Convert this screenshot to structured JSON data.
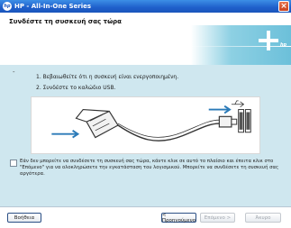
{
  "window": {
    "title": "HP - All-In-One Series",
    "app_icon": "hp-logo-icon",
    "close_glyph": "×"
  },
  "header": {
    "heading": "Συνδέστε τη συσκευή σας τώρα",
    "brand_text": "hp"
  },
  "content": {
    "dash": "-",
    "steps": [
      "1. Βεβαιωθείτε ότι η συσκευή είναι ενεργοποιημένη.",
      "2. Συνδέστε το καλώδιο USB."
    ],
    "illustration": "usb-cable-connection-illustration",
    "checkbox_checked": false,
    "note": "Εάν δεν μπορείτε να συνδέσετε τη συσκευή σας τώρα, κάντε κλικ σε αυτό το πλαίσιο και έπειτα κλικ στο \"Επόμενο\" για να ολοκληρώσετε την εγκατάσταση του λογισμικού. Μπορείτε να συνδέσετε τη συσκευή σας αργότερα."
  },
  "footer": {
    "help_label": "Βοήθεια",
    "back_label": "< Προηγούμενο",
    "next_label": "Επόμενο >",
    "cancel_label": "Άκυρο"
  },
  "colors": {
    "titlebar": "#1f5fcb",
    "content_background": "#cfe7ef",
    "banner": "#8dd0e3"
  }
}
